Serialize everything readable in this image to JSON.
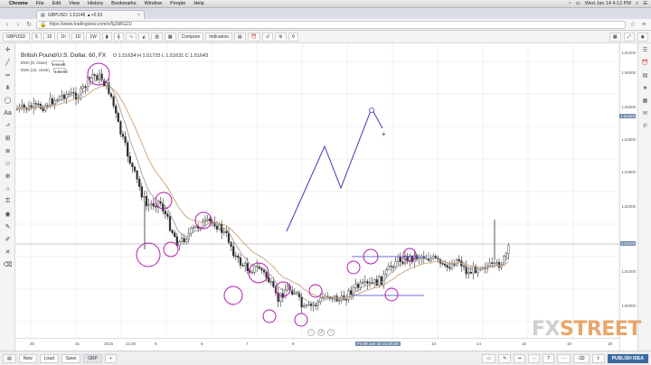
{
  "menubar": {
    "apple": "",
    "items": [
      "Chrome",
      "File",
      "Edit",
      "View",
      "History",
      "Bookmarks",
      "Window",
      "People",
      "Help"
    ],
    "clock": "Wed Jan 14  4:12 PM"
  },
  "browser": {
    "tab_title": "GBPUSD: 1.51148 ▲+0.53",
    "url": "https://www.tradingview.com/v/5jZkBG21/"
  },
  "toolbar": {
    "symbol": "GBPUSD",
    "intervals": [
      "5",
      "15",
      "1h",
      "1D",
      "1W"
    ],
    "compare": "Compare",
    "indicators": "Indicators"
  },
  "legend": {
    "title": "British Pound/U.S. Dollar, 60, FX",
    "ohlc": "O 1.51634  H 1.51725  L 1.51631  C 1.51643",
    "ema1": "EMA (5, close)",
    "ema1_val": "1.51.68",
    "ema2": "EMA (12, close)",
    "ema2_val": "1.51.52"
  },
  "price_axis": {
    "labels": [
      "1.56000",
      "1.55000",
      "1.54000",
      "1.53000",
      "1.52000",
      "1.51000",
      "1.50000"
    ],
    "highlight": "1.51643",
    "highlight2": "1.51148",
    "top_label": "1.51000"
  },
  "time_axis": {
    "labels": [
      "30",
      "31",
      "2015",
      "11:00",
      "5",
      "6",
      "7",
      "8",
      "9",
      "12",
      "13",
      "14",
      "15",
      "16",
      "19"
    ],
    "cursor": "Fri 09 Jan 15 21:00:00"
  },
  "bottombar": {
    "buttons": [
      "New",
      "Load",
      "Save",
      "GBP"
    ],
    "publish": "PUBLISH IDEA"
  },
  "watermark": {
    "main": "FX",
    "accent": "STREET"
  },
  "colors": {
    "bull": "#2c2c2c",
    "bear": "#2c2c2c",
    "ema_fast": "#a0a0a0",
    "ema_slow": "#c9a27a",
    "annotation": "#b21db0",
    "projection": "#3b3bb5",
    "level": "#6c6cd6"
  }
}
